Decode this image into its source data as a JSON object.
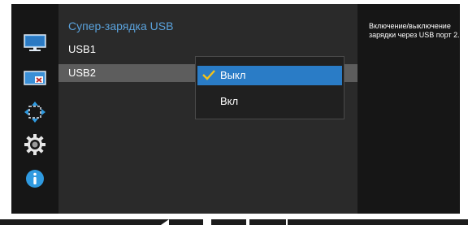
{
  "menu": {
    "title": "Супер-зарядка USB",
    "items": [
      {
        "label": "USB1"
      },
      {
        "label": "USB2"
      }
    ]
  },
  "dropdown": {
    "options": [
      {
        "label": "Выкл",
        "selected": true
      },
      {
        "label": "Вкл",
        "selected": false
      }
    ]
  },
  "help": {
    "text": "Включение/выключение зарядки через USB порт 2."
  },
  "sidebar": {
    "icons": [
      "monitor-icon",
      "picture-size-icon",
      "position-arrows-icon",
      "gear-icon",
      "info-icon"
    ]
  },
  "bottom_bar": {
    "icons": [
      "left-button-icon",
      "menu-button-icon",
      "up-button-icon",
      "power-button-icon"
    ]
  },
  "colors": {
    "accent": "#5aa2dc",
    "selected_option": "#2a7cc6",
    "selected_row": "#5d5d5d",
    "panel": "#2a2a2a",
    "background": "#161616"
  }
}
